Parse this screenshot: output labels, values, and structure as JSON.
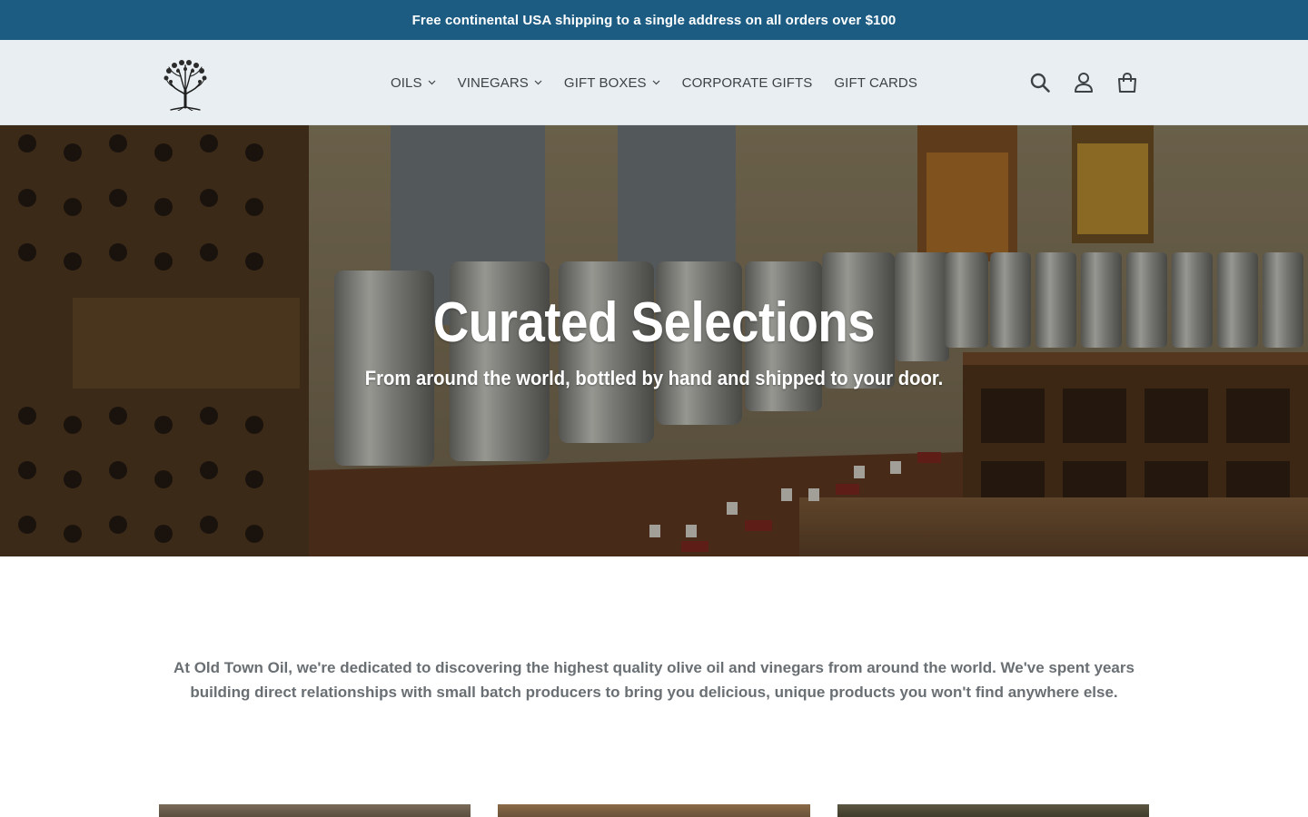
{
  "announcement": {
    "text": "Free continental USA shipping to a single address on all orders over $100"
  },
  "header": {
    "nav": [
      {
        "label": "OILS",
        "has_dropdown": true
      },
      {
        "label": "VINEGARS",
        "has_dropdown": true
      },
      {
        "label": "GIFT BOXES",
        "has_dropdown": true
      },
      {
        "label": "CORPORATE GIFTS",
        "has_dropdown": false
      },
      {
        "label": "GIFT CARDS",
        "has_dropdown": false
      }
    ],
    "icons": [
      "search-icon",
      "account-icon",
      "cart-icon"
    ]
  },
  "hero": {
    "title": "Curated Selections",
    "subtitle": "From around the world, bottled by hand and shipped to your door."
  },
  "intro": {
    "text": "At Old Town Oil, we're dedicated to discovering the highest quality olive oil and vinegars from around the world. We've spent years building direct relationships with small batch producers to bring you delicious, unique products you won't find anywhere else."
  },
  "colors": {
    "announcement_bg": "#1c5c83",
    "header_bg": "#e8eef1",
    "nav_text": "#3d4246",
    "intro_text": "#6a6f73"
  }
}
